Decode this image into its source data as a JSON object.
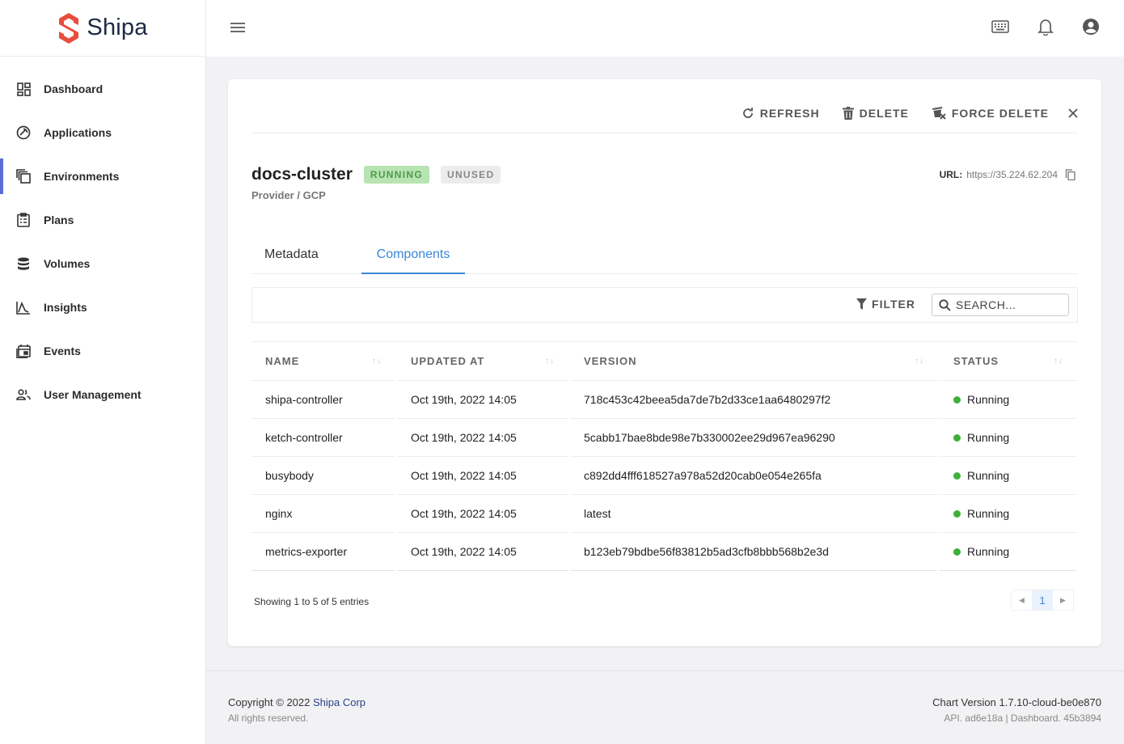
{
  "brand": {
    "name": "Shipa",
    "logo_color": "#e84c3d"
  },
  "sidebar": {
    "items": [
      {
        "label": "Dashboard",
        "icon": "dashboard-icon"
      },
      {
        "label": "Applications",
        "icon": "applications-icon"
      },
      {
        "label": "Environments",
        "icon": "environments-icon",
        "active": true
      },
      {
        "label": "Plans",
        "icon": "plans-icon"
      },
      {
        "label": "Volumes",
        "icon": "volumes-icon"
      },
      {
        "label": "Insights",
        "icon": "insights-icon"
      },
      {
        "label": "Events",
        "icon": "events-icon"
      },
      {
        "label": "User Management",
        "icon": "user-management-icon"
      }
    ],
    "active_color": "#5b6cd4"
  },
  "card": {
    "actions": {
      "refresh": "REFRESH",
      "delete": "DELETE",
      "force_delete": "FORCE DELETE"
    },
    "title": "docs-cluster",
    "badges": {
      "running": "RUNNING",
      "unused": "UNUSED"
    },
    "provider": "Provider / GCP",
    "url_label": "URL:",
    "url_value": "https://35.224.62.204",
    "tabs": {
      "metadata": "Metadata",
      "components": "Components"
    },
    "filter_label": "FILTER",
    "search_placeholder": "SEARCH..."
  },
  "table": {
    "columns": [
      "NAME",
      "UPDATED AT",
      "VERSION",
      "STATUS"
    ],
    "rows": [
      {
        "name": "shipa-controller",
        "updated": "Oct 19th, 2022 14:05",
        "version": "718c453c42beea5da7de7b2d33ce1aa6480297f2",
        "status": "Running"
      },
      {
        "name": "ketch-controller",
        "updated": "Oct 19th, 2022 14:05",
        "version": "5cabb17bae8bde98e7b330002ee29d967ea96290",
        "status": "Running"
      },
      {
        "name": "busybody",
        "updated": "Oct 19th, 2022 14:05",
        "version": "c892dd4fff618527a978a52d20cab0e054e265fa",
        "status": "Running"
      },
      {
        "name": "nginx",
        "updated": "Oct 19th, 2022 14:05",
        "version": "latest",
        "status": "Running"
      },
      {
        "name": "metrics-exporter",
        "updated": "Oct 19th, 2022 14:05",
        "version": "b123eb79bdbe56f83812b5ad3cfb8bbb568b2e3d",
        "status": "Running"
      }
    ],
    "info": "Showing 1 to 5 of 5 entries",
    "page": "1",
    "status_color": "#3db03a"
  },
  "footer": {
    "copyright": "Copyright © 2022 ",
    "company": "Shipa Corp",
    "rights": "All rights reserved.",
    "chart_version": "Chart Version 1.7.10-cloud-be0e870",
    "build": "API. ad6e18a | Dashboard. 45b3894"
  }
}
